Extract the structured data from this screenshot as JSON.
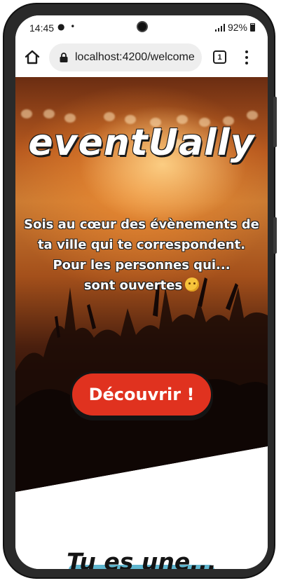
{
  "status_bar": {
    "time": "14:45",
    "indicators": "● •",
    "battery": "92%",
    "icons": [
      "spotify-icon",
      "signal-icon",
      "battery-icon"
    ]
  },
  "browser": {
    "url": "localhost:4200/welcome",
    "tab_count": "1",
    "icons": [
      "home-icon",
      "lock-icon",
      "tabs-icon",
      "more-icon"
    ]
  },
  "hero": {
    "brand": "eventUally",
    "tagline_lines": [
      "Sois au cœur des évènements de",
      "ta ville qui te correspondent.",
      "Pour les personnes qui...",
      "sont ouvertes"
    ],
    "tagline_emoji": "hugging-face-icon",
    "cta_label": "Découvrir !"
  },
  "next_section": {
    "title": "Tu es une..."
  },
  "colors": {
    "cta": "#e0321f",
    "accent_band": "#5fb6cf",
    "text_dark": "#141414"
  }
}
